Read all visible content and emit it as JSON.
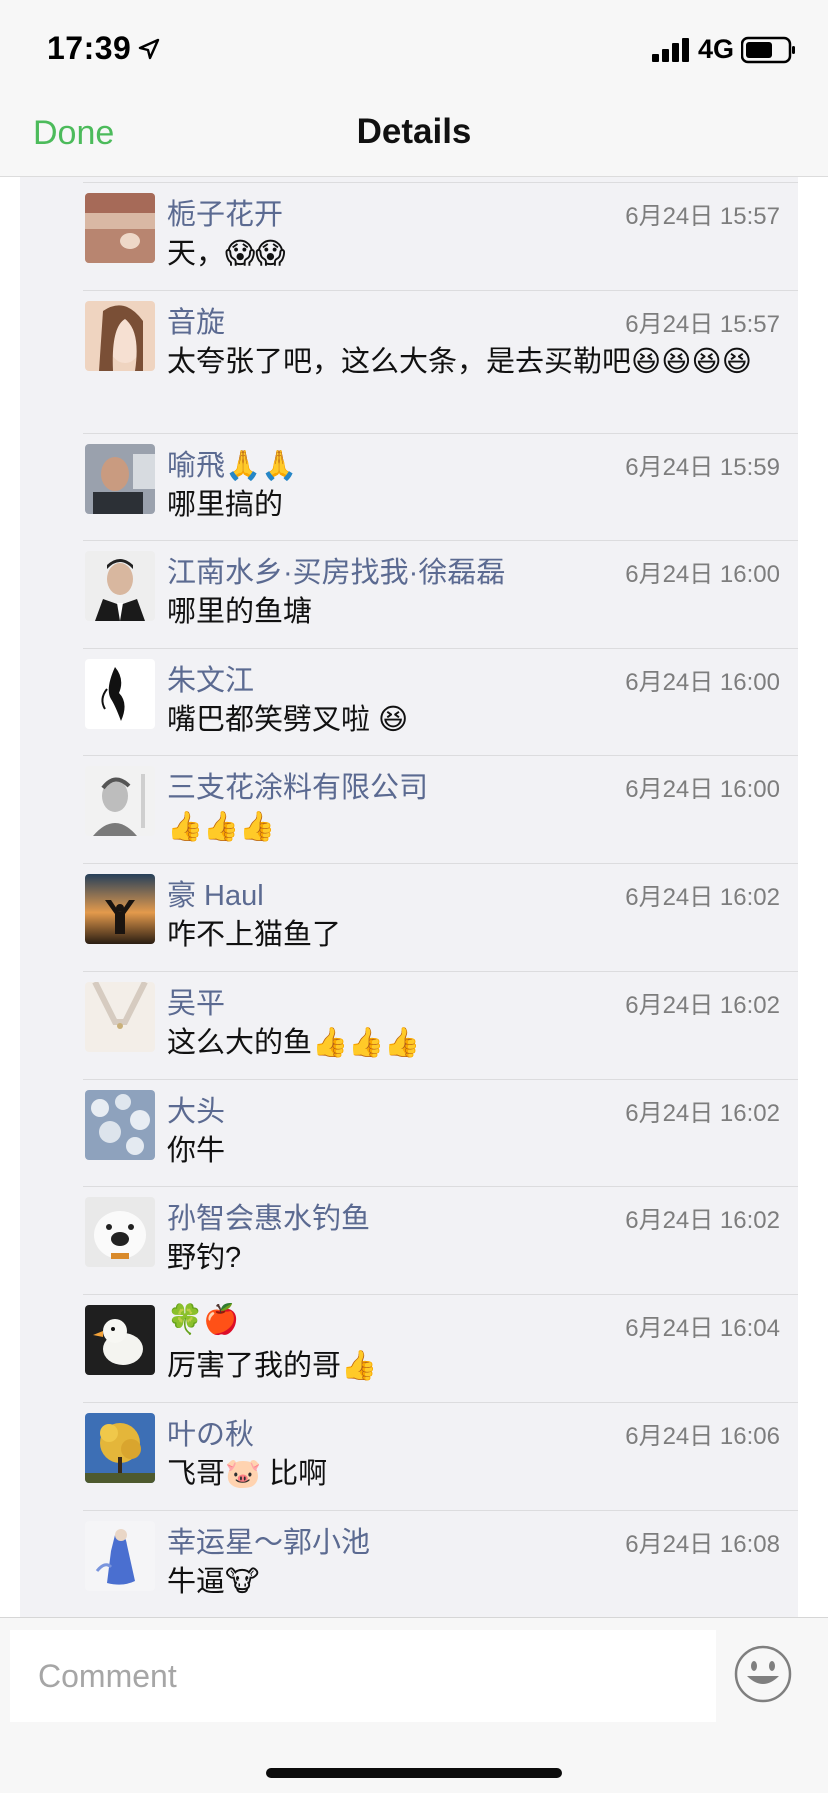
{
  "status_bar": {
    "time": "17:39",
    "network": "4G"
  },
  "nav": {
    "done_label": "Done",
    "title": "Details"
  },
  "comments": [
    {
      "name": "栀子花开",
      "time": "6月24日 15:57",
      "text": "天，😱😱"
    },
    {
      "name": "音旋",
      "time": "6月24日 15:57",
      "text": "太夸张了吧，这么大条，是去买勒吧😆😆😆😆"
    },
    {
      "name": "喻飛🙏🙏",
      "time": "6月24日 15:59",
      "text": "哪里搞的"
    },
    {
      "name": "江南水乡·买房找我·徐磊磊",
      "time": "6月24日 16:00",
      "text": "哪里的鱼塘"
    },
    {
      "name": "朱文江",
      "time": "6月24日 16:00",
      "text": "嘴巴都笑劈叉啦 😆"
    },
    {
      "name": "三支花涂料有限公司",
      "time": "6月24日 16:00",
      "text": "👍👍👍"
    },
    {
      "name": "豪 Haul",
      "time": "6月24日 16:02",
      "text": "咋不上猫鱼了"
    },
    {
      "name": "吴平",
      "time": "6月24日 16:02",
      "text": "这么大的鱼👍👍👍"
    },
    {
      "name": "大头",
      "time": "6月24日 16:02",
      "text": "你牛"
    },
    {
      "name": "孙智会惠水钓鱼",
      "time": "6月24日 16:02",
      "text": "野钓?"
    },
    {
      "name": "🍀🍎",
      "time": "6月24日 16:04",
      "text": "厉害了我的哥👍"
    },
    {
      "name": "叶の秋",
      "time": "6月24日 16:06",
      "text": "飞哥🐷 比啊"
    },
    {
      "name": "幸运星～郭小池",
      "time": "6月24日 16:08",
      "text": "牛逼🐮"
    }
  ],
  "input": {
    "placeholder": "Comment"
  }
}
